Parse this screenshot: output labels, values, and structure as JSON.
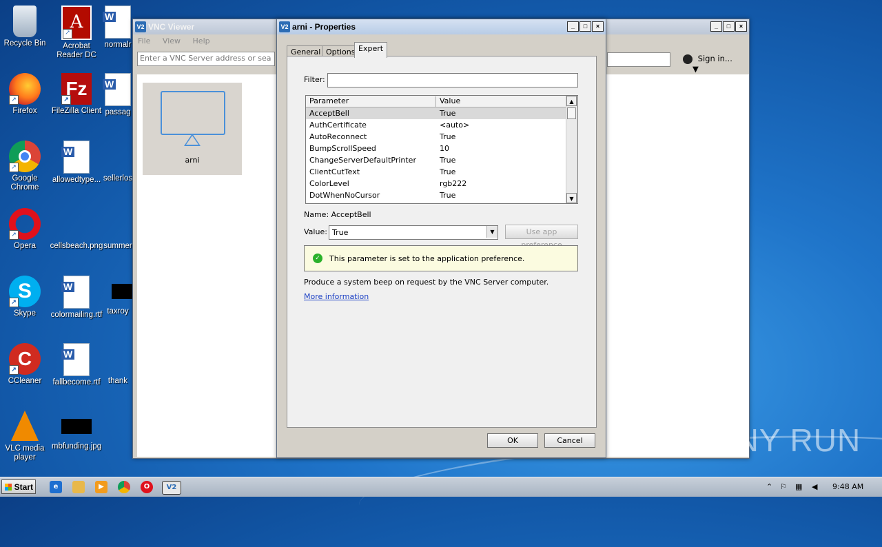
{
  "desktop": {
    "icons": [
      {
        "label": "Recycle Bin",
        "icon": "recycle-bin-icon"
      },
      {
        "label": "Acrobat Reader DC",
        "icon": "acrobat-icon"
      },
      {
        "label": "normalr",
        "icon": "word-doc-icon"
      },
      {
        "label": "Firefox",
        "icon": "firefox-icon"
      },
      {
        "label": "FileZilla Client",
        "icon": "filezilla-icon"
      },
      {
        "label": "passag",
        "icon": "word-doc-icon"
      },
      {
        "label": "Google Chrome",
        "icon": "chrome-icon"
      },
      {
        "label": "allowedtype...",
        "icon": "word-doc-icon"
      },
      {
        "label": "sellerlos",
        "icon": "file-icon"
      },
      {
        "label": "Opera",
        "icon": "opera-icon"
      },
      {
        "label": "cellsbeach.png",
        "icon": "image-icon"
      },
      {
        "label": "summer",
        "icon": "file-icon"
      },
      {
        "label": "Skype",
        "icon": "skype-icon"
      },
      {
        "label": "colormailing.rtf",
        "icon": "word-doc-icon"
      },
      {
        "label": "taxroy",
        "icon": "image-icon"
      },
      {
        "label": "CCleaner",
        "icon": "ccleaner-icon"
      },
      {
        "label": "fallbecome.rtf",
        "icon": "word-doc-icon"
      },
      {
        "label": "thank",
        "icon": "file-icon"
      },
      {
        "label": "VLC media player",
        "icon": "vlc-icon"
      },
      {
        "label": "mbfunding.jpg",
        "icon": "image-icon"
      }
    ]
  },
  "vnc_viewer": {
    "title": "VNC Viewer",
    "menu": [
      "File",
      "View",
      "Help"
    ],
    "search_placeholder": "Enter a VNC Server address or search",
    "sign_in": "Sign in...",
    "connection": {
      "name": "arni"
    }
  },
  "properties": {
    "title": "arni - Properties",
    "tabs": [
      "General",
      "Options",
      "Expert"
    ],
    "selected_tab": "Expert",
    "filter_label": "Filter:",
    "filter_value": "",
    "columns": [
      "Parameter",
      "Value"
    ],
    "rows": [
      {
        "param": "AcceptBell",
        "value": "True"
      },
      {
        "param": "AuthCertificate",
        "value": "<auto>"
      },
      {
        "param": "AutoReconnect",
        "value": "True"
      },
      {
        "param": "BumpScrollSpeed",
        "value": "10"
      },
      {
        "param": "ChangeServerDefaultPrinter",
        "value": "True"
      },
      {
        "param": "ClientCutText",
        "value": "True"
      },
      {
        "param": "ColorLevel",
        "value": "rgb222"
      },
      {
        "param": "DotWhenNoCursor",
        "value": "True"
      }
    ],
    "name_label": "Name:",
    "name_value": "AcceptBell",
    "value_label": "Value:",
    "value_selected": "True",
    "use_app_pref": "Use app preference",
    "notice": "This parameter is set to the application preference.",
    "description": "Produce a system beep on request by the VNC Server computer.",
    "more_info": "More information",
    "ok": "OK",
    "cancel": "Cancel"
  },
  "taskbar": {
    "start": "Start",
    "clock": "9:48 AM"
  },
  "watermark": "ANY RUN"
}
